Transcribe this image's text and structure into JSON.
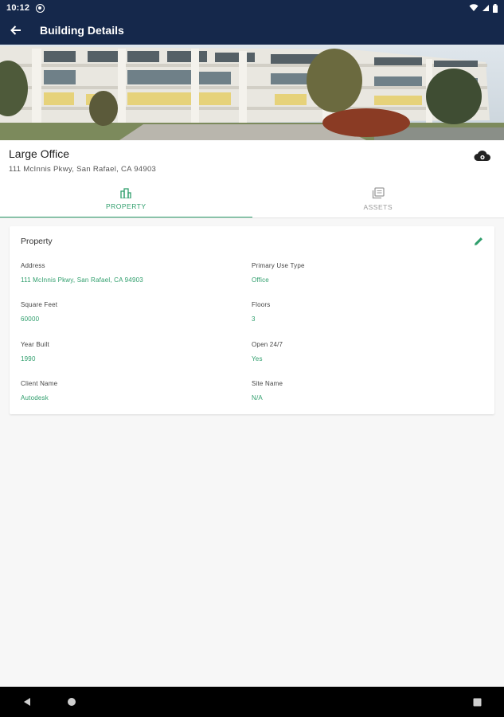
{
  "status_bar": {
    "time": "10:12"
  },
  "app_bar": {
    "title": "Building Details"
  },
  "building": {
    "name": "Large Office",
    "address": "111 McInnis Pkwy, San Rafael, CA 94903"
  },
  "tabs": [
    {
      "label": "PROPERTY",
      "active": true,
      "icon": "building-icon"
    },
    {
      "label": "ASSETS",
      "active": false,
      "icon": "assets-icon"
    }
  ],
  "property_card": {
    "title": "Property",
    "fields": [
      {
        "label": "Address",
        "value": "111 McInnis Pkwy, San Rafael, CA 94903"
      },
      {
        "label": "Primary Use Type",
        "value": "Office"
      },
      {
        "label": "Square Feet",
        "value": "60000"
      },
      {
        "label": "Floors",
        "value": "3"
      },
      {
        "label": "Year Built",
        "value": "1990"
      },
      {
        "label": "Open 24/7",
        "value": "Yes"
      },
      {
        "label": "Client Name",
        "value": "Autodesk"
      },
      {
        "label": "Site Name",
        "value": "N/A"
      }
    ]
  },
  "colors": {
    "primary": "#15284b",
    "accent": "#2f9e6c",
    "background": "#f7f7f7"
  }
}
